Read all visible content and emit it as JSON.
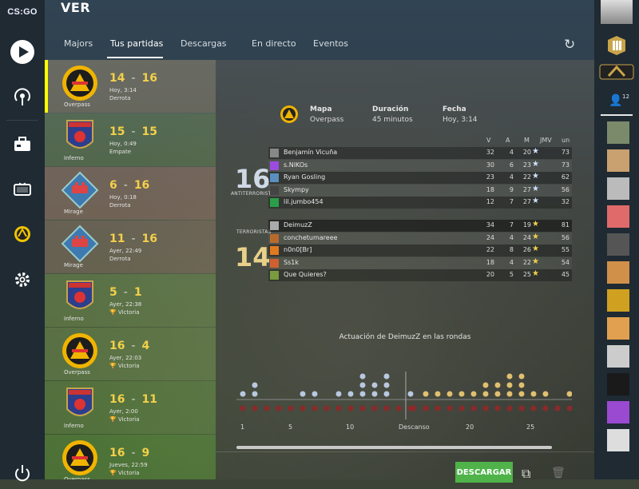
{
  "app": {
    "logo_text": "CS:GO",
    "title": "VER"
  },
  "nav_tabs": [
    "Majors",
    "Tus partidas",
    "Descargas",
    "En directo",
    "Eventos"
  ],
  "left_rail_icons": [
    "play-icon",
    "broadcast-icon",
    "briefcase-icon",
    "tv-icon",
    "watch-badge-icon",
    "gear-icon",
    "power-icon"
  ],
  "matches": [
    {
      "map": "Overpass",
      "score_a": "14",
      "score_b": "16",
      "when": "Hoy, 3:14",
      "result": "Derrota",
      "selected": true
    },
    {
      "map": "Inferno",
      "score_a": "15",
      "score_b": "15",
      "when": "Hoy, 0:49",
      "result": "Empate"
    },
    {
      "map": "Mirage",
      "score_a": "6",
      "score_b": "16",
      "when": "Hoy, 0:18",
      "result": "Derrota"
    },
    {
      "map": "Mirage",
      "score_a": "11",
      "score_b": "16",
      "when": "Ayer, 22:49",
      "result": "Derrota"
    },
    {
      "map": "Inferno",
      "score_a": "5",
      "score_b": "1",
      "when": "Ayer, 22:38",
      "result": "Victoria"
    },
    {
      "map": "Overpass",
      "score_a": "16",
      "score_b": "4",
      "when": "Ayer, 22:03",
      "result": "Victoria"
    },
    {
      "map": "Inferno",
      "score_a": "16",
      "score_b": "11",
      "when": "Ayer, 2:00",
      "result": "Victoria"
    },
    {
      "map": "Overpass",
      "score_a": "16",
      "score_b": "9",
      "when": "Jueves, 22:59",
      "result": "Victoria"
    }
  ],
  "summary": {
    "map_label": "Mapa",
    "map_value": "Overpass",
    "duration_label": "Duración",
    "duration_value": "45 minutos",
    "date_label": "Fecha",
    "date_value": "Hoy, 3:14"
  },
  "columns": [
    "V",
    "A",
    "M",
    "JMV",
    "un"
  ],
  "teams": [
    {
      "name": "ANTITERRORISTAS",
      "score": "16",
      "players": [
        {
          "name": "Benjamín Vicuña",
          "k": "32",
          "a": "4",
          "d": "20",
          "mvp": "★",
          "un": "73"
        },
        {
          "name": "s.NIKOs",
          "k": "30",
          "a": "6",
          "d": "23",
          "mvp": "★",
          "un": "73"
        },
        {
          "name": "Ryan Gosling",
          "k": "23",
          "a": "4",
          "d": "22",
          "mvp": "★",
          "un": "62"
        },
        {
          "name": "Skympy",
          "k": "18",
          "a": "9",
          "d": "27",
          "mvp": "★",
          "un": "56"
        },
        {
          "name": "lil.jumbo454",
          "k": "12",
          "a": "7",
          "d": "27",
          "mvp": "★",
          "un": "32"
        }
      ]
    },
    {
      "name": "TERRORISTAS",
      "score": "14",
      "players": [
        {
          "name": "DeimuzZ",
          "k": "34",
          "a": "7",
          "d": "19",
          "mvp": "★",
          "un": "81"
        },
        {
          "name": "conchetumareee",
          "k": "24",
          "a": "4",
          "d": "24",
          "mvp": "★",
          "un": "56"
        },
        {
          "name": "n0n0[Br]",
          "k": "22",
          "a": "8",
          "d": "26",
          "mvp": "★",
          "un": "55"
        },
        {
          "name": "Ss1k",
          "k": "18",
          "a": "4",
          "d": "22",
          "mvp": "★",
          "un": "54"
        },
        {
          "name": "Que Quieres?",
          "k": "20",
          "a": "5",
          "d": "25",
          "mvp": "★",
          "un": "45"
        }
      ]
    }
  ],
  "rounds_chart": {
    "title": "Actuación de DeimuzZ en las rondas",
    "x_labels": [
      "1",
      "5",
      "10",
      "Descanso",
      "20",
      "25"
    ],
    "ct_skulls_top": [
      1,
      2,
      0,
      0,
      0,
      1,
      1,
      0,
      1,
      1,
      3,
      2,
      3,
      0,
      1
    ],
    "t_skulls_top": [
      0,
      1,
      1,
      1,
      1,
      1,
      2,
      2,
      3,
      3,
      1,
      1,
      0,
      1,
      2,
      3
    ]
  },
  "footer": {
    "download_label": "DESCARGAR"
  },
  "friends": {
    "count": "12"
  },
  "colors": {
    "accent": "#f3d04a",
    "download": "#4fb34a",
    "rail": "#1f2a33"
  }
}
